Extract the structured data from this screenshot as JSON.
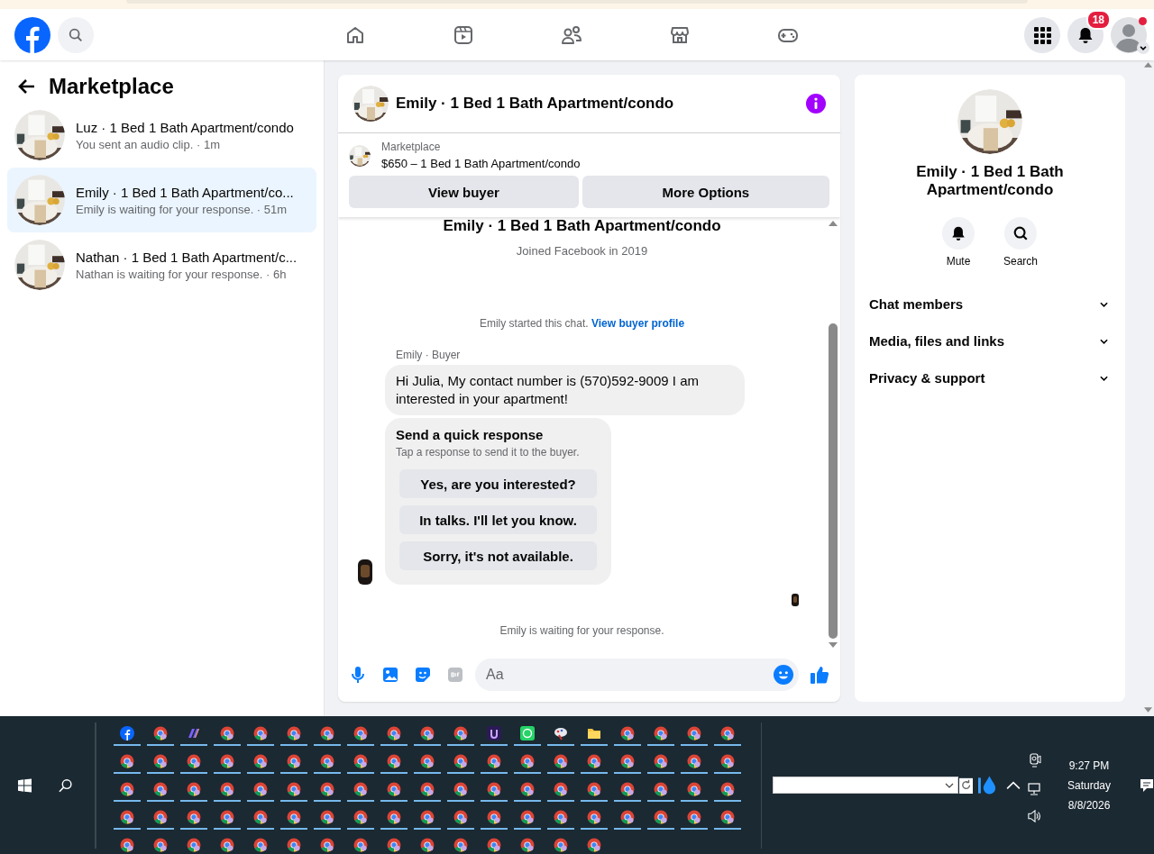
{
  "top_bar": {
    "notifications_badge": "18"
  },
  "sidebar": {
    "title": "Marketplace",
    "conversations": [
      {
        "name": "Luz · 1 Bed 1 Bath Apartment/condo",
        "preview": "You sent an audio clip. · 1m",
        "selected": false
      },
      {
        "name": "Emily · 1 Bed 1 Bath Apartment/co...",
        "preview": "Emily is waiting for your response. · 51m",
        "selected": true
      },
      {
        "name": "Nathan · 1 Bed 1 Bath Apartment/c...",
        "preview": "Nathan is waiting for your response. · 6h",
        "selected": false
      }
    ]
  },
  "chat": {
    "title": "Emily · 1 Bed 1 Bath Apartment/condo",
    "listing": {
      "label": "Marketplace",
      "text": "$650 – 1 Bed 1 Bath Apartment/condo",
      "buttons": [
        "View buyer",
        "More Options"
      ]
    },
    "intro": {
      "title": "Emily · 1 Bed 1 Bath Apartment/condo",
      "joined": "Joined Facebook in 2019",
      "started": "Emily started this chat.",
      "link": "View buyer profile"
    },
    "sender": "Emily · Buyer",
    "message": "Hi Julia, My contact number is (570)592-9009 I am interested in your apartment!",
    "quick_response": {
      "title": "Send a quick response",
      "subtitle": "Tap a response to send it to the buyer.",
      "options": [
        "Yes, are you interested?",
        "In talks. I'll let you know.",
        "Sorry, it's not available."
      ]
    },
    "status": "Emily is waiting for your response.",
    "composer": {
      "placeholder": "Aa"
    }
  },
  "details": {
    "title": "Emily · 1 Bed 1 Bath Apartment/condo",
    "actions": [
      {
        "kind": "mute",
        "label": "Mute"
      },
      {
        "kind": "search",
        "label": "Search"
      }
    ],
    "sections": [
      {
        "label": "Chat members",
        "expanded": false
      },
      {
        "label": "Media, files and links",
        "expanded": false
      },
      {
        "label": "Privacy & support",
        "expanded": false
      }
    ]
  },
  "taskbar": {
    "time": "9:27 PM",
    "day": "Saturday",
    "date": "8/8/2026"
  }
}
